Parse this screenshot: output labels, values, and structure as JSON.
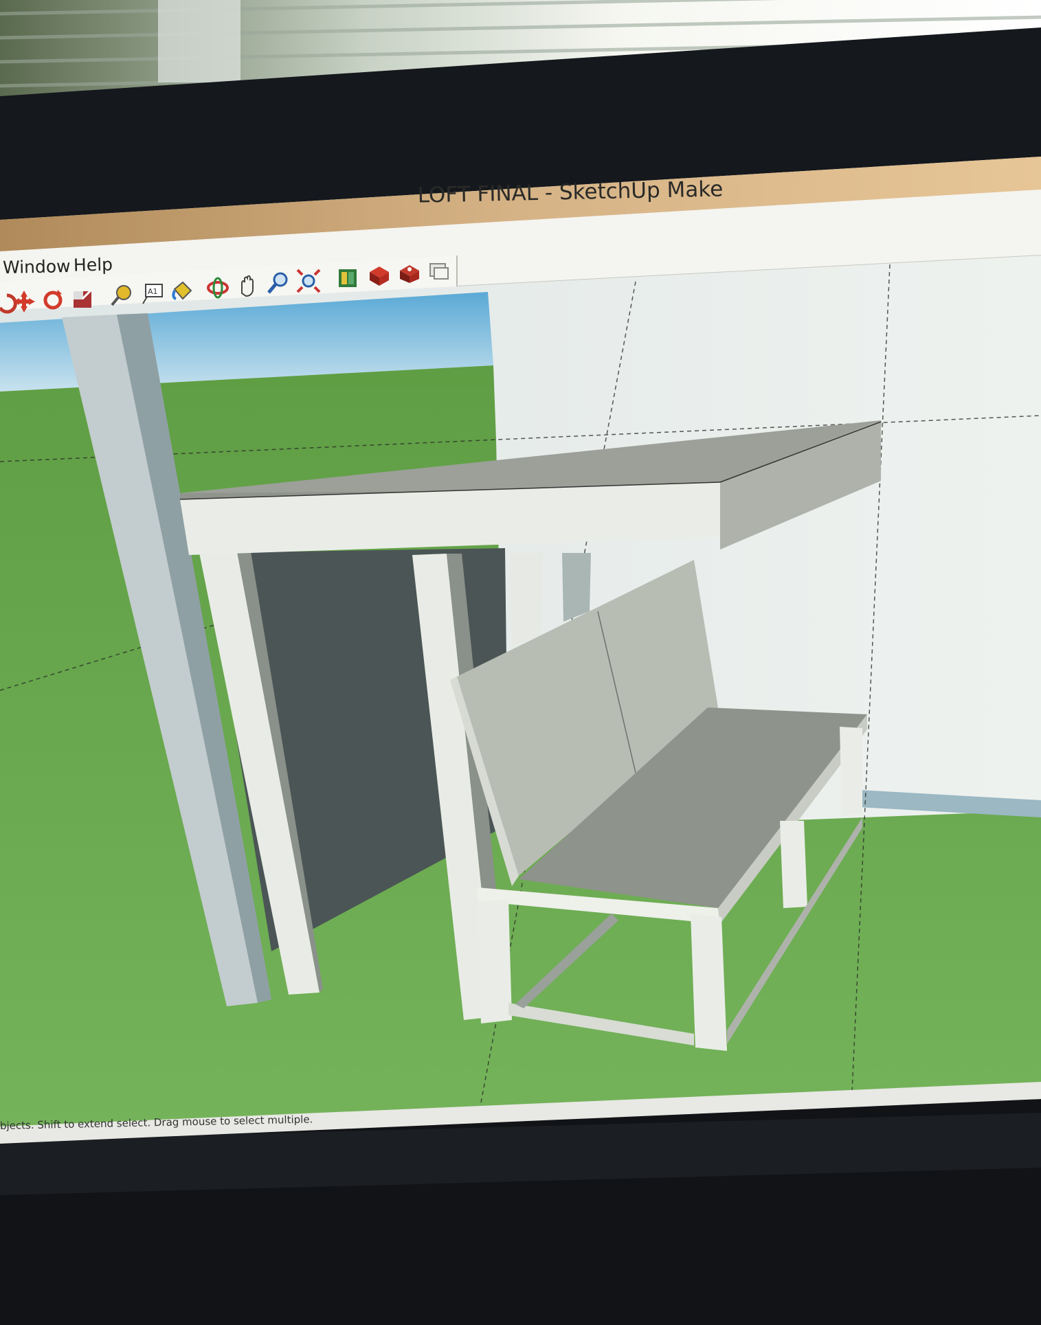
{
  "window": {
    "title": "LOFT FINAL - SketchUp Make"
  },
  "menu": {
    "items": [
      {
        "label": "Window"
      },
      {
        "label": "Help"
      }
    ]
  },
  "toolbar": {
    "tools": [
      {
        "icon": "undo-icon"
      },
      {
        "icon": "move-icon"
      },
      {
        "icon": "rotate-icon"
      },
      {
        "icon": "scale-icon"
      },
      {
        "icon": "tape-measure-icon"
      },
      {
        "icon": "text-icon"
      },
      {
        "icon": "paint-bucket-icon"
      },
      {
        "icon": "orbit-icon"
      },
      {
        "icon": "pan-icon"
      },
      {
        "icon": "zoom-icon"
      },
      {
        "icon": "zoom-extents-icon"
      },
      {
        "icon": "3d-warehouse-icon"
      },
      {
        "icon": "share-model-icon"
      },
      {
        "icon": "extension-warehouse-icon"
      },
      {
        "icon": "layout-icon"
      }
    ]
  },
  "status_bar": {
    "hint": "bjects. Shift to extend select. Drag mouse to select multiple."
  },
  "colors": {
    "titlebar": "#c8a06a",
    "ground": "#6aa84f",
    "sky": "#8ecbe6",
    "model_face": "#e8ebe6",
    "model_shadow": "#8e938c"
  }
}
